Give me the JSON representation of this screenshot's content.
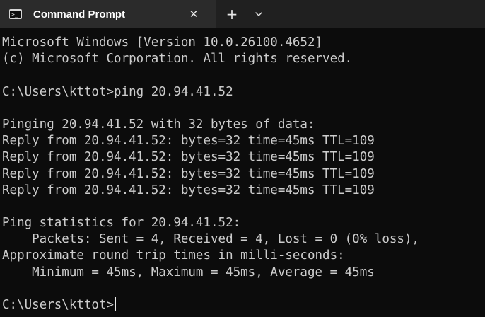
{
  "window": {
    "tab": {
      "title": "Command Prompt",
      "icon": "terminal-icon",
      "icon_glyph": ">_",
      "close_glyph": "✕"
    },
    "new_tab_glyph": "+",
    "dropdown_icon": "chevron-down-icon"
  },
  "console": {
    "lines": [
      "Microsoft Windows [Version 10.0.26100.4652]",
      "(c) Microsoft Corporation. All rights reserved.",
      "",
      "C:\\Users\\kttot>ping 20.94.41.52",
      "",
      "Pinging 20.94.41.52 with 32 bytes of data:",
      "Reply from 20.94.41.52: bytes=32 time=45ms TTL=109",
      "Reply from 20.94.41.52: bytes=32 time=45ms TTL=109",
      "Reply from 20.94.41.52: bytes=32 time=45ms TTL=109",
      "Reply from 20.94.41.52: bytes=32 time=45ms TTL=109",
      "",
      "Ping statistics for 20.94.41.52:",
      "    Packets: Sent = 4, Received = 4, Lost = 0 (0% loss),",
      "Approximate round trip times in milli-seconds:",
      "    Minimum = 45ms, Maximum = 45ms, Average = 45ms",
      ""
    ],
    "prompt": "C:\\Users\\kttot>"
  },
  "colors": {
    "background": "#0c0c0c",
    "text": "#cccccc",
    "tabstrip": "#202020",
    "active_tab": "#2b2b2b"
  }
}
